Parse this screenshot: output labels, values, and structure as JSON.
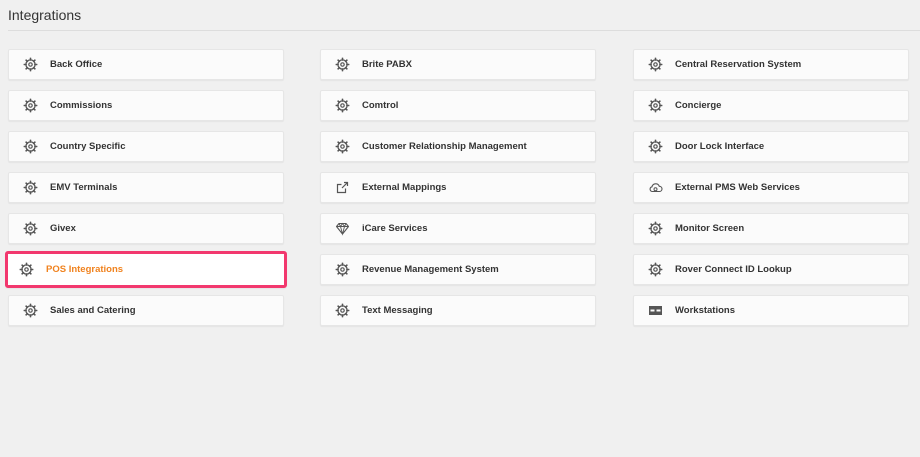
{
  "header": {
    "title": "Integrations"
  },
  "colors": {
    "accent_border": "#f2386e",
    "selected_text": "#f0821e",
    "text": "#333333"
  },
  "columns": [
    {
      "items": [
        {
          "label": "Back Office",
          "icon": "gear-icon"
        },
        {
          "label": "Commissions",
          "icon": "gear-icon"
        },
        {
          "label": "Country Specific",
          "icon": "gear-icon"
        },
        {
          "label": "EMV Terminals",
          "icon": "gear-icon"
        },
        {
          "label": "Givex",
          "icon": "gear-icon"
        },
        {
          "label": "POS Integrations",
          "icon": "gear-icon",
          "selected": true
        },
        {
          "label": "Sales and Catering",
          "icon": "gear-icon"
        }
      ]
    },
    {
      "items": [
        {
          "label": "Brite PABX",
          "icon": "gear-icon"
        },
        {
          "label": "Comtrol",
          "icon": "gear-icon"
        },
        {
          "label": "Customer Relationship Management",
          "icon": "gear-icon"
        },
        {
          "label": "External Mappings",
          "icon": "external-link-icon"
        },
        {
          "label": "iCare Services",
          "icon": "diamond-icon"
        },
        {
          "label": "Revenue Management System",
          "icon": "gear-icon"
        },
        {
          "label": "Text Messaging",
          "icon": "gear-icon"
        }
      ]
    },
    {
      "items": [
        {
          "label": "Central Reservation System",
          "icon": "gear-icon"
        },
        {
          "label": "Concierge",
          "icon": "gear-icon"
        },
        {
          "label": "Door Lock Interface",
          "icon": "gear-icon"
        },
        {
          "label": "External PMS Web Services",
          "icon": "cloud-icon"
        },
        {
          "label": "Monitor Screen",
          "icon": "gear-icon"
        },
        {
          "label": "Rover Connect ID Lookup",
          "icon": "gear-icon"
        },
        {
          "label": "Workstations",
          "icon": "workstation-icon"
        }
      ]
    }
  ]
}
